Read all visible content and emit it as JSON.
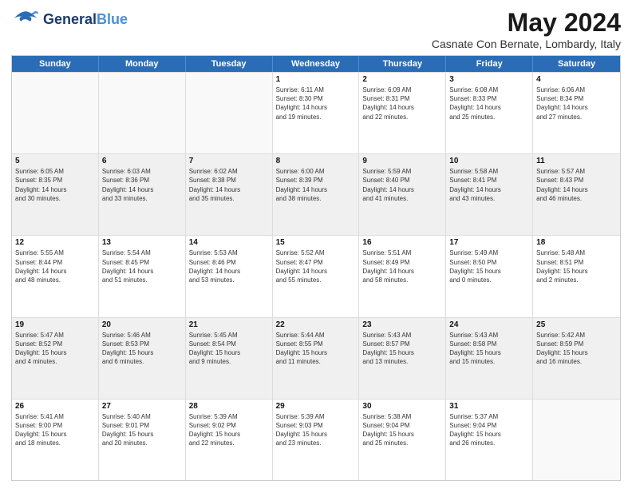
{
  "header": {
    "logo": {
      "line1": "General",
      "line2": "Blue",
      "tagline": ""
    },
    "title": "May 2024",
    "subtitle": "Casnate Con Bernate, Lombardy, Italy"
  },
  "days_of_week": [
    "Sunday",
    "Monday",
    "Tuesday",
    "Wednesday",
    "Thursday",
    "Friday",
    "Saturday"
  ],
  "rows": [
    [
      {
        "day": "",
        "info": ""
      },
      {
        "day": "",
        "info": ""
      },
      {
        "day": "",
        "info": ""
      },
      {
        "day": "1",
        "info": "Sunrise: 6:11 AM\nSunset: 8:30 PM\nDaylight: 14 hours\nand 19 minutes."
      },
      {
        "day": "2",
        "info": "Sunrise: 6:09 AM\nSunset: 8:31 PM\nDaylight: 14 hours\nand 22 minutes."
      },
      {
        "day": "3",
        "info": "Sunrise: 6:08 AM\nSunset: 8:33 PM\nDaylight: 14 hours\nand 25 minutes."
      },
      {
        "day": "4",
        "info": "Sunrise: 6:06 AM\nSunset: 8:34 PM\nDaylight: 14 hours\nand 27 minutes."
      }
    ],
    [
      {
        "day": "5",
        "info": "Sunrise: 6:05 AM\nSunset: 8:35 PM\nDaylight: 14 hours\nand 30 minutes."
      },
      {
        "day": "6",
        "info": "Sunrise: 6:03 AM\nSunset: 8:36 PM\nDaylight: 14 hours\nand 33 minutes."
      },
      {
        "day": "7",
        "info": "Sunrise: 6:02 AM\nSunset: 8:38 PM\nDaylight: 14 hours\nand 35 minutes."
      },
      {
        "day": "8",
        "info": "Sunrise: 6:00 AM\nSunset: 8:39 PM\nDaylight: 14 hours\nand 38 minutes."
      },
      {
        "day": "9",
        "info": "Sunrise: 5:59 AM\nSunset: 8:40 PM\nDaylight: 14 hours\nand 41 minutes."
      },
      {
        "day": "10",
        "info": "Sunrise: 5:58 AM\nSunset: 8:41 PM\nDaylight: 14 hours\nand 43 minutes."
      },
      {
        "day": "11",
        "info": "Sunrise: 5:57 AM\nSunset: 8:43 PM\nDaylight: 14 hours\nand 46 minutes."
      }
    ],
    [
      {
        "day": "12",
        "info": "Sunrise: 5:55 AM\nSunset: 8:44 PM\nDaylight: 14 hours\nand 48 minutes."
      },
      {
        "day": "13",
        "info": "Sunrise: 5:54 AM\nSunset: 8:45 PM\nDaylight: 14 hours\nand 51 minutes."
      },
      {
        "day": "14",
        "info": "Sunrise: 5:53 AM\nSunset: 8:46 PM\nDaylight: 14 hours\nand 53 minutes."
      },
      {
        "day": "15",
        "info": "Sunrise: 5:52 AM\nSunset: 8:47 PM\nDaylight: 14 hours\nand 55 minutes."
      },
      {
        "day": "16",
        "info": "Sunrise: 5:51 AM\nSunset: 8:49 PM\nDaylight: 14 hours\nand 58 minutes."
      },
      {
        "day": "17",
        "info": "Sunrise: 5:49 AM\nSunset: 8:50 PM\nDaylight: 15 hours\nand 0 minutes."
      },
      {
        "day": "18",
        "info": "Sunrise: 5:48 AM\nSunset: 8:51 PM\nDaylight: 15 hours\nand 2 minutes."
      }
    ],
    [
      {
        "day": "19",
        "info": "Sunrise: 5:47 AM\nSunset: 8:52 PM\nDaylight: 15 hours\nand 4 minutes."
      },
      {
        "day": "20",
        "info": "Sunrise: 5:46 AM\nSunset: 8:53 PM\nDaylight: 15 hours\nand 6 minutes."
      },
      {
        "day": "21",
        "info": "Sunrise: 5:45 AM\nSunset: 8:54 PM\nDaylight: 15 hours\nand 9 minutes."
      },
      {
        "day": "22",
        "info": "Sunrise: 5:44 AM\nSunset: 8:55 PM\nDaylight: 15 hours\nand 11 minutes."
      },
      {
        "day": "23",
        "info": "Sunrise: 5:43 AM\nSunset: 8:57 PM\nDaylight: 15 hours\nand 13 minutes."
      },
      {
        "day": "24",
        "info": "Sunrise: 5:43 AM\nSunset: 8:58 PM\nDaylight: 15 hours\nand 15 minutes."
      },
      {
        "day": "25",
        "info": "Sunrise: 5:42 AM\nSunset: 8:59 PM\nDaylight: 15 hours\nand 16 minutes."
      }
    ],
    [
      {
        "day": "26",
        "info": "Sunrise: 5:41 AM\nSunset: 9:00 PM\nDaylight: 15 hours\nand 18 minutes."
      },
      {
        "day": "27",
        "info": "Sunrise: 5:40 AM\nSunset: 9:01 PM\nDaylight: 15 hours\nand 20 minutes."
      },
      {
        "day": "28",
        "info": "Sunrise: 5:39 AM\nSunset: 9:02 PM\nDaylight: 15 hours\nand 22 minutes."
      },
      {
        "day": "29",
        "info": "Sunrise: 5:39 AM\nSunset: 9:03 PM\nDaylight: 15 hours\nand 23 minutes."
      },
      {
        "day": "30",
        "info": "Sunrise: 5:38 AM\nSunset: 9:04 PM\nDaylight: 15 hours\nand 25 minutes."
      },
      {
        "day": "31",
        "info": "Sunrise: 5:37 AM\nSunset: 9:04 PM\nDaylight: 15 hours\nand 26 minutes."
      },
      {
        "day": "",
        "info": ""
      }
    ]
  ],
  "alt_rows": [
    false,
    true,
    false,
    true,
    false
  ]
}
